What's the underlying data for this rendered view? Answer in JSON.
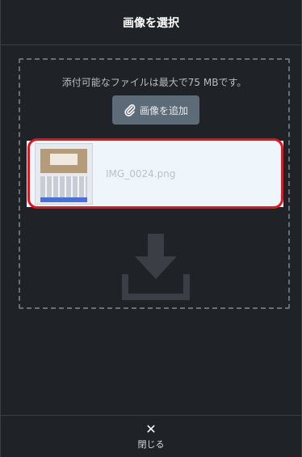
{
  "header": {
    "title": "画像を選択"
  },
  "upload": {
    "limit_text": "添付可能なファイルは最大で75 MBです。",
    "add_button_label": "画像を追加",
    "add_button_icon": "paperclip-icon"
  },
  "files": [
    {
      "name": "IMG_0024.png",
      "thumbnail_icon": "image-thumbnail"
    }
  ],
  "dropzone": {
    "icon": "download-icon"
  },
  "footer": {
    "close_glyph": "✕",
    "close_label": "閉じる"
  },
  "colors": {
    "background": "#1f2226",
    "button": "#5d6b78",
    "card": "#eef5fb",
    "highlight": "#e5141d"
  }
}
